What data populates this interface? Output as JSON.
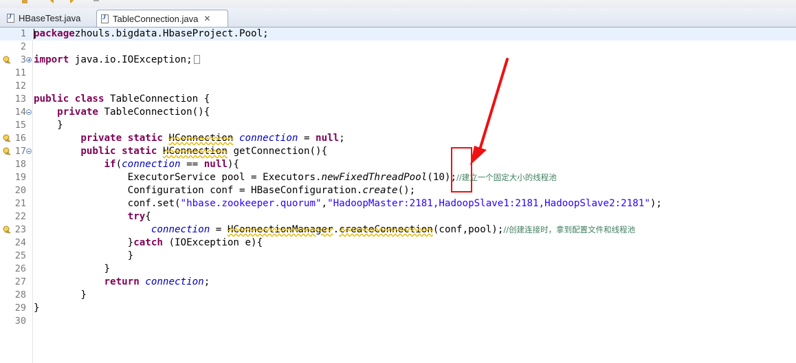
{
  "tabs": [
    {
      "label": "HBaseTest.java",
      "icon": "java-file-icon",
      "active": false
    },
    {
      "label": "TableConnection.java",
      "icon": "java-file-icon",
      "active": true,
      "close_icon": "close-icon"
    }
  ],
  "colors": {
    "keyword": "#7f0055",
    "field": "#0000c0",
    "string": "#2a00ff",
    "comment": "#3f7f5f",
    "line_number": "#787878",
    "annotation": "#ee1111"
  },
  "editor": {
    "current_line": "1",
    "lines": [
      {
        "num": "1",
        "t": [
          [
            "kw",
            "package"
          ],
          [
            "",
            "zhouls.bigdata.HbaseProject.Pool;"
          ]
        ]
      },
      {
        "num": "2",
        "t": []
      },
      {
        "num": "3",
        "t": [
          [
            "kw",
            "import"
          ],
          [
            "",
            " java.io.IOException;"
          ]
        ]
      },
      {
        "num": "11",
        "t": []
      },
      {
        "num": "12",
        "t": []
      },
      {
        "num": "13",
        "t": [
          [
            "kw",
            "public"
          ],
          [
            "",
            " "
          ],
          [
            "kw",
            "class"
          ],
          [
            "",
            " TableConnection {"
          ]
        ]
      },
      {
        "num": "14",
        "t": [
          [
            "",
            "    "
          ],
          [
            "kw",
            "private"
          ],
          [
            "",
            " TableConnection(){"
          ]
        ]
      },
      {
        "num": "15",
        "t": [
          [
            "",
            "    }"
          ]
        ]
      },
      {
        "num": "16",
        "t": [
          [
            "",
            "        "
          ],
          [
            "kw",
            "private"
          ],
          [
            "",
            " "
          ],
          [
            "kw",
            "static"
          ],
          [
            "",
            " "
          ],
          [
            "depw",
            "HConnection"
          ],
          [
            "",
            " "
          ],
          [
            "fld",
            "connection"
          ],
          [
            "",
            " = "
          ],
          [
            "kw",
            "null"
          ],
          [
            "",
            ";"
          ]
        ]
      },
      {
        "num": "17",
        "t": [
          [
            "",
            "        "
          ],
          [
            "kw",
            "public"
          ],
          [
            "",
            " "
          ],
          [
            "kw",
            "static"
          ],
          [
            "",
            " "
          ],
          [
            "depw",
            "HConnection"
          ],
          [
            "",
            " getConnection(){"
          ]
        ]
      },
      {
        "num": "18",
        "t": [
          [
            "",
            "            "
          ],
          [
            "kw",
            "if"
          ],
          [
            "",
            "("
          ],
          [
            "fld",
            "connection"
          ],
          [
            "",
            " == "
          ],
          [
            "kw",
            "null"
          ],
          [
            "",
            "){"
          ]
        ]
      },
      {
        "num": "19",
        "t": [
          [
            "",
            "                ExecutorService pool = Executors."
          ],
          [
            "it",
            "newFixedThreadPool"
          ],
          [
            "",
            "(10);"
          ],
          [
            "cmt",
            "//建立一个固定大小的线程池"
          ]
        ]
      },
      {
        "num": "20",
        "t": [
          [
            "",
            "                Configuration conf = HBaseConfiguration."
          ],
          [
            "it",
            "create"
          ],
          [
            "",
            "();"
          ]
        ]
      },
      {
        "num": "21",
        "t": [
          [
            "",
            "                conf.set("
          ],
          [
            "str",
            "\"hbase.zookeeper.quorum\""
          ],
          [
            "",
            ","
          ],
          [
            "str",
            "\"HadoopMaster:2181,HadoopSlave1:2181,HadoopSlave2:2181\""
          ],
          [
            "",
            ");"
          ]
        ]
      },
      {
        "num": "22",
        "t": [
          [
            "",
            "                "
          ],
          [
            "kw",
            "try"
          ],
          [
            "",
            "{"
          ]
        ]
      },
      {
        "num": "23",
        "t": [
          [
            "",
            "                    "
          ],
          [
            "fld",
            "connection"
          ],
          [
            "",
            " = "
          ],
          [
            "depw",
            "HConnectionManager"
          ],
          [
            "",
            "."
          ],
          [
            "depw",
            "createConnection"
          ],
          [
            "",
            "(conf,pool);"
          ],
          [
            "cmt",
            "//创建连接时，拿到配置文件和线程池"
          ]
        ]
      },
      {
        "num": "24",
        "t": [
          [
            "",
            "                }"
          ],
          [
            "kw",
            "catch"
          ],
          [
            "",
            " (IOException e){"
          ]
        ]
      },
      {
        "num": "25",
        "t": [
          [
            "",
            "                }"
          ]
        ]
      },
      {
        "num": "26",
        "t": [
          [
            "",
            "            }"
          ]
        ]
      },
      {
        "num": "27",
        "t": [
          [
            "",
            "            "
          ],
          [
            "kw",
            "return"
          ],
          [
            "",
            " "
          ],
          [
            "fld",
            "connection"
          ],
          [
            "",
            ";"
          ]
        ]
      },
      {
        "num": "28",
        "t": [
          [
            "",
            "        }"
          ]
        ]
      },
      {
        "num": "29",
        "t": [
          [
            "",
            "}"
          ]
        ]
      },
      {
        "num": "30",
        "t": []
      }
    ]
  },
  "gutter_markers": {
    "warning_lines": [
      "3",
      "16",
      "17",
      "23"
    ],
    "fold_collapsed_lines": [
      "3"
    ],
    "fold_expanded_lines": [
      "14",
      "17"
    ]
  },
  "icons": {
    "warning": "warning-lightbulb-icon",
    "fold_collapsed": "fold-expand-icon",
    "fold_expanded": "fold-collapse-icon",
    "annotation_arrow": "red-arrow-icon"
  }
}
